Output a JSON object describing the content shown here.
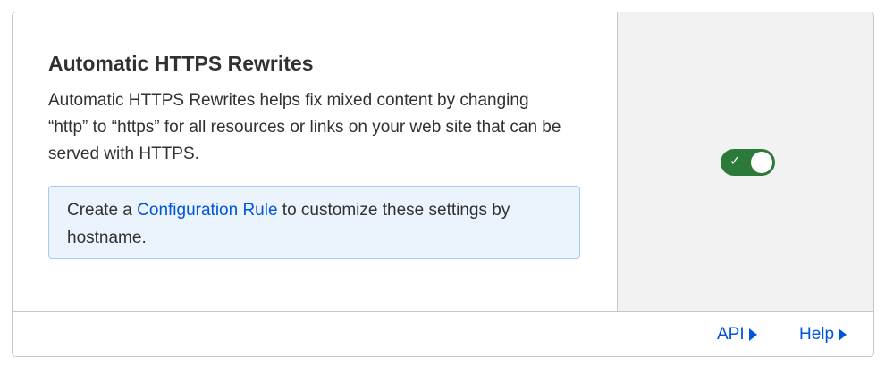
{
  "setting": {
    "title": "Automatic HTTPS Rewrites",
    "description": "Automatic HTTPS Rewrites helps fix mixed content by changing “http” to “https” for all resources or links on your web site that can be served with HTTPS."
  },
  "info_box": {
    "text_before": "Create a ",
    "link_text": "Configuration Rule",
    "text_after": " to customize these settings by hostname."
  },
  "toggle": {
    "state": "on",
    "check_icon": "check-icon",
    "color": "#2c7a3a"
  },
  "footer": {
    "api_label": "API",
    "help_label": "Help"
  },
  "colors": {
    "link": "#0055dc",
    "info_bg": "#ebf3fd",
    "info_border": "#a9c9ee",
    "side_bg": "#f2f2f2"
  }
}
